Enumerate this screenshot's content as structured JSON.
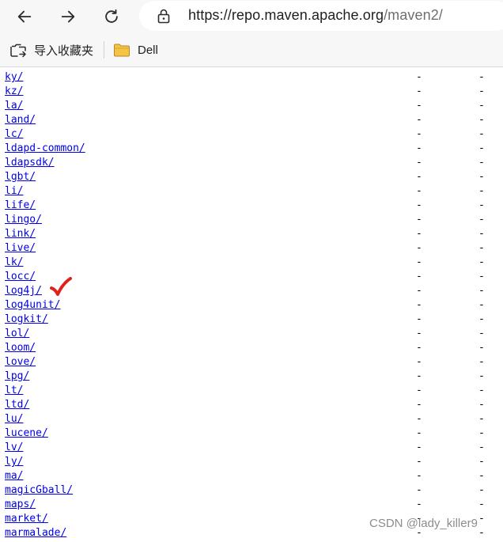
{
  "browser": {
    "url_host": "https://repo.maven.apache.org",
    "url_path": "/maven2/"
  },
  "bookmarks": [
    {
      "label": "导入收藏夹",
      "icon": "import-favorites-icon"
    },
    {
      "label": "Dell",
      "icon": "folder-icon"
    }
  ],
  "listing": {
    "rows": [
      {
        "name": "ky/",
        "date": "-",
        "size": "-"
      },
      {
        "name": "kz/",
        "date": "-",
        "size": "-"
      },
      {
        "name": "la/",
        "date": "-",
        "size": "-"
      },
      {
        "name": "land/",
        "date": "-",
        "size": "-"
      },
      {
        "name": "lc/",
        "date": "-",
        "size": "-"
      },
      {
        "name": "ldapd-common/",
        "date": "-",
        "size": "-"
      },
      {
        "name": "ldapsdk/",
        "date": "-",
        "size": "-"
      },
      {
        "name": "lgbt/",
        "date": "-",
        "size": "-"
      },
      {
        "name": "li/",
        "date": "-",
        "size": "-"
      },
      {
        "name": "life/",
        "date": "-",
        "size": "-"
      },
      {
        "name": "lingo/",
        "date": "-",
        "size": "-"
      },
      {
        "name": "link/",
        "date": "-",
        "size": "-"
      },
      {
        "name": "live/",
        "date": "-",
        "size": "-"
      },
      {
        "name": "lk/",
        "date": "-",
        "size": "-"
      },
      {
        "name": "locc/",
        "date": "-",
        "size": "-"
      },
      {
        "name": "log4j/",
        "date": "-",
        "size": "-"
      },
      {
        "name": "log4unit/",
        "date": "-",
        "size": "-"
      },
      {
        "name": "logkit/",
        "date": "-",
        "size": "-"
      },
      {
        "name": "lol/",
        "date": "-",
        "size": "-"
      },
      {
        "name": "loom/",
        "date": "-",
        "size": "-"
      },
      {
        "name": "love/",
        "date": "-",
        "size": "-"
      },
      {
        "name": "lpg/",
        "date": "-",
        "size": "-"
      },
      {
        "name": "lt/",
        "date": "-",
        "size": "-"
      },
      {
        "name": "ltd/",
        "date": "-",
        "size": "-"
      },
      {
        "name": "lu/",
        "date": "-",
        "size": "-"
      },
      {
        "name": "lucene/",
        "date": "-",
        "size": "-"
      },
      {
        "name": "lv/",
        "date": "-",
        "size": "-"
      },
      {
        "name": "ly/",
        "date": "-",
        "size": "-"
      },
      {
        "name": "ma/",
        "date": "-",
        "size": "-"
      },
      {
        "name": "magicGball/",
        "date": "-",
        "size": "-"
      },
      {
        "name": "maps/",
        "date": "-",
        "size": "-"
      },
      {
        "name": "market/",
        "date": "-",
        "size": "-"
      },
      {
        "name": "marmalade/",
        "date": "-",
        "size": "-"
      }
    ]
  },
  "annotation": {
    "icon": "red-checkmark-icon",
    "color": "#e0201b",
    "marked_item": "log4j/"
  },
  "watermark": "CSDN @lady_killer9",
  "colors": {
    "link": "#0000ee",
    "chrome": "#f7f7f7",
    "folder": "#f5c443"
  }
}
